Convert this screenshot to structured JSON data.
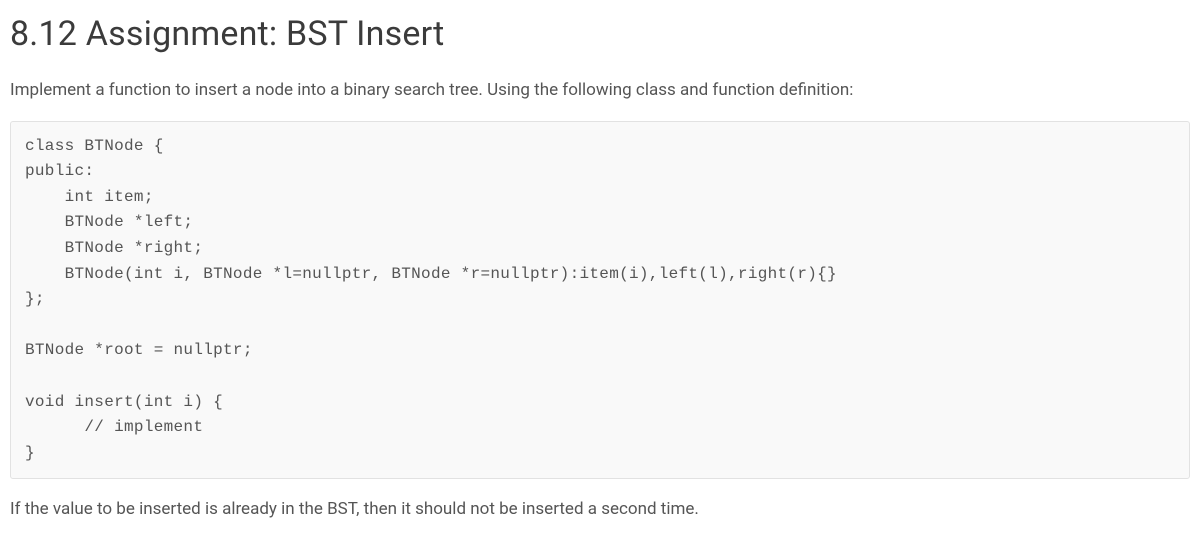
{
  "heading": "8.12 Assignment: BST Insert",
  "intro": "Implement a function to insert a node into a binary search tree. Using the following class and function definition:",
  "code": "class BTNode {\npublic:\n    int item;\n    BTNode *left;\n    BTNode *right;\n    BTNode(int i, BTNode *l=nullptr, BTNode *r=nullptr):item(i),left(l),right(r){}\n};\n\nBTNode *root = nullptr;\n\nvoid insert(int i) {\n      // implement\n}",
  "note": "If the value to be inserted is already in the BST, then it should not be inserted a second time."
}
